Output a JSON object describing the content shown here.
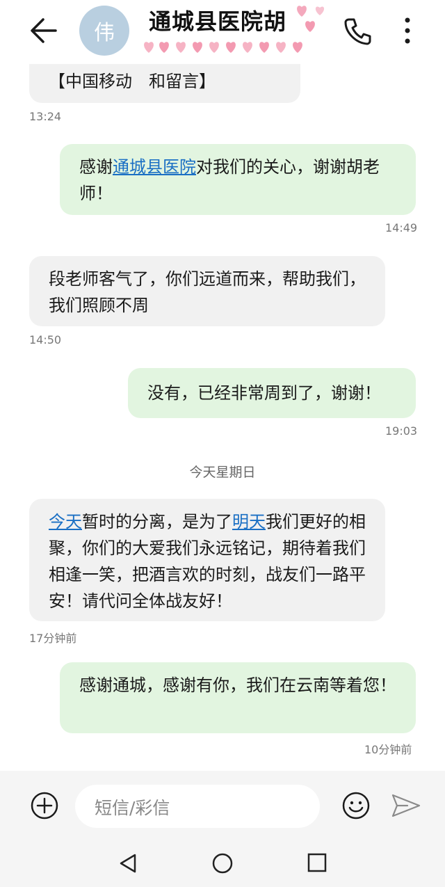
{
  "header": {
    "avatar_char": "伟",
    "title": "通城县医院胡"
  },
  "messages": [
    {
      "id": "m1",
      "direction": "incoming",
      "segments": [
        {
          "text": "【中国移动　和留言】",
          "link": false
        }
      ],
      "time": "13:24"
    },
    {
      "id": "m2",
      "direction": "outgoing",
      "segments": [
        {
          "text": "感谢",
          "link": false
        },
        {
          "text": "通城县医院",
          "link": true
        },
        {
          "text": "对我们的关心，谢谢胡老师！",
          "link": false
        }
      ],
      "time": "14:49"
    },
    {
      "id": "m3",
      "direction": "incoming",
      "segments": [
        {
          "text": "段老师客气了，你们远道而来，帮助我们，我们照顾不周",
          "link": false
        }
      ],
      "time": "14:50"
    },
    {
      "id": "m4",
      "direction": "outgoing",
      "segments": [
        {
          "text": "没有，已经非常周到了，谢谢！",
          "link": false
        }
      ],
      "time": "19:03"
    },
    {
      "id": "m5",
      "direction": "incoming",
      "segments": [
        {
          "text": "今天",
          "link": true
        },
        {
          "text": "暂时的分离，是为了",
          "link": false
        },
        {
          "text": "明天",
          "link": true
        },
        {
          "text": "我们更好的相聚，你们的大爱我们永远铭记，期待着我们相逢一笑，把酒言欢的时刻，战友们一路平安！请代问全体战友好！",
          "link": false
        }
      ],
      "time": "17分钟前"
    },
    {
      "id": "m6",
      "direction": "outgoing",
      "segments": [
        {
          "text": "感谢通城，感谢有你，我们在云南等着您！",
          "link": false
        }
      ],
      "time": "10分钟前"
    }
  ],
  "day_separator": "今天星期日",
  "composer": {
    "placeholder": "短信/彩信"
  },
  "colors": {
    "incoming_bubble": "#f1f1f1",
    "outgoing_bubble": "#e2f5e0",
    "link": "#1a6fc4",
    "avatar": "#b9cfe0"
  },
  "icons": [
    "back-arrow-icon",
    "phone-icon",
    "more-vertical-icon",
    "plus-circle-icon",
    "smiley-icon",
    "send-icon",
    "nav-back-icon",
    "nav-home-icon",
    "nav-recents-icon"
  ]
}
